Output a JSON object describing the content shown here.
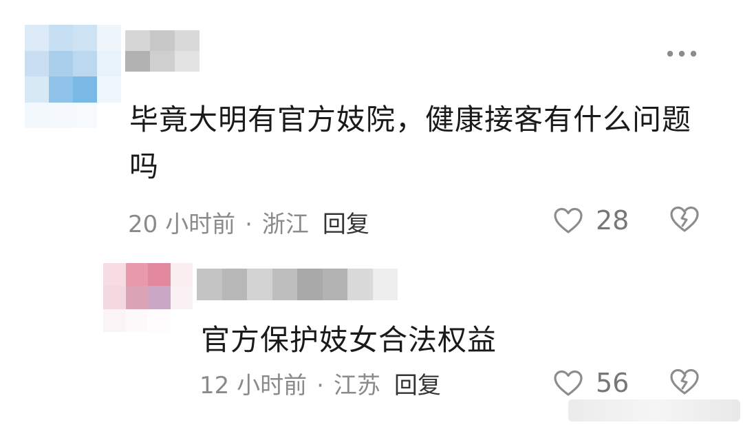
{
  "comments": [
    {
      "text": "毕竟大明有官方妓院，健康接客有什么问题吗",
      "time": "20 小时前",
      "separator": "·",
      "location": "浙江",
      "reply_label": "回复",
      "likes": "28"
    },
    {
      "text": "官方保护妓女合法权益",
      "time": "12 小时前",
      "separator": "·",
      "location": "江苏",
      "reply_label": "回复",
      "likes": "56"
    }
  ],
  "colors": {
    "text": "#1a1a1a",
    "meta": "#8a8a8a",
    "reply": "#333333",
    "icon": "#8c8c8c",
    "avatar1_mosaic": [
      "#dbeaf6",
      "#c6dff2",
      "#cde3f4",
      "#eef5fb",
      "#c9dff1",
      "#a9cfec",
      "#bcd8ef",
      "#e8f2fa",
      "#d8e9f6",
      "#8fc3e9",
      "#7ab8e6",
      "#eff6fc",
      "#f3f8fc",
      "#f5f9fd",
      "#f7fafd",
      "#ffffff"
    ],
    "avatar2_mosaic": [
      "#f7dde3",
      "#e89aab",
      "#e2889e",
      "#fbeef1",
      "#f4d8e0",
      "#dba4b6",
      "#c9a6c4",
      "#f8f0f3",
      "#fbf4f6",
      "#fdf8fa",
      "#fefcfd",
      "#ffffff"
    ],
    "user1_mosaic": [
      "#d6d6d6",
      "#c8c8c8",
      "#d9d9d9",
      "#b2b2b2",
      "#cfcfcf",
      "#e3e3e3"
    ],
    "user2_mosaic": [
      "#c4c4c4",
      "#b8b8b8",
      "#d2d2d2",
      "#bebebe",
      "#a9a9a9",
      "#b3b3b3",
      "#d9d9d9",
      "#ededed"
    ]
  },
  "icons": {
    "more": "more-horizontal-icon",
    "like": "heart-outline-icon",
    "dislike": "broken-heart-icon"
  }
}
